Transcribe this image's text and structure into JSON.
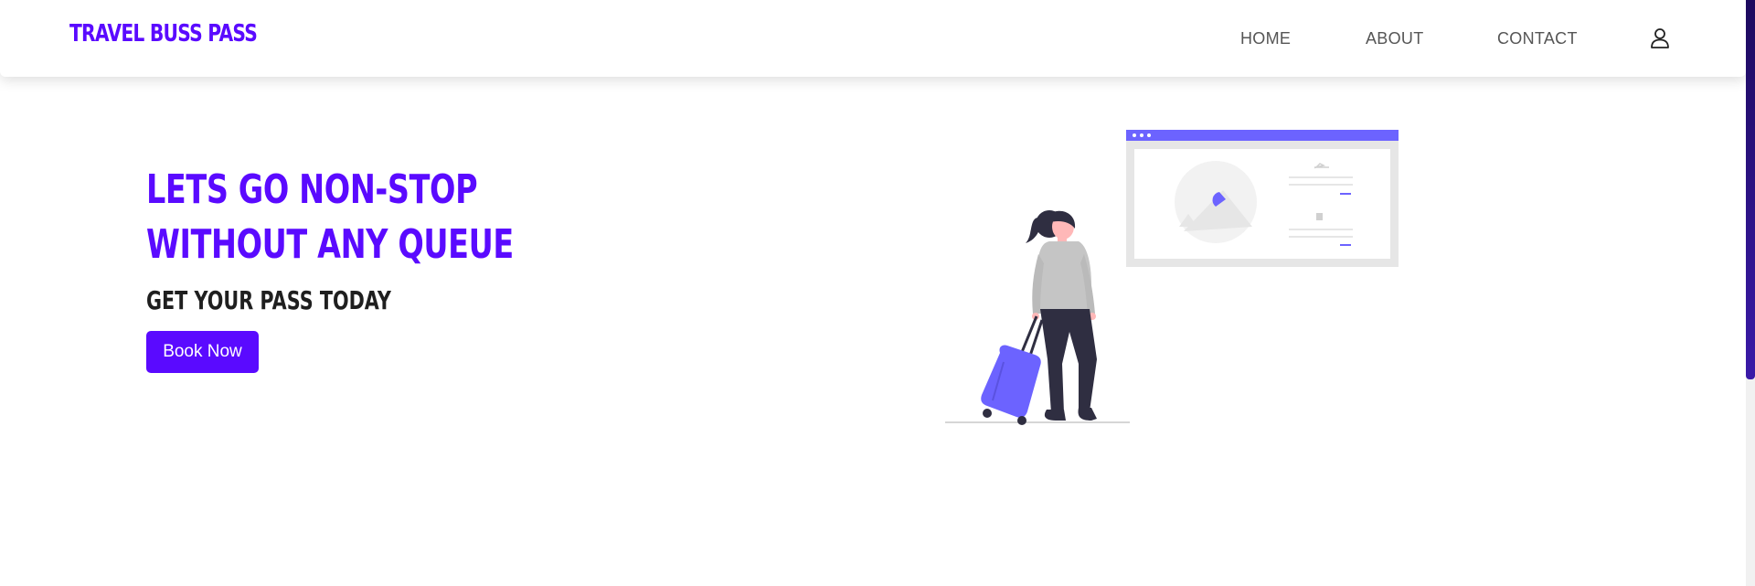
{
  "navbar": {
    "brand": "TRAVEL BUSS PASS",
    "links": [
      "HOME",
      "ABOUT",
      "CONTACT"
    ]
  },
  "hero": {
    "title_line1": "LETS GO NON-STOP",
    "title_line2": "WITHOUT ANY QUEUE",
    "subtitle": "GET YOUR PASS TODAY",
    "cta_label": "Book Now"
  },
  "colors": {
    "accent": "#5a0aff",
    "illustration_purple": "#6c63ff"
  },
  "icons": [
    "user-icon"
  ]
}
